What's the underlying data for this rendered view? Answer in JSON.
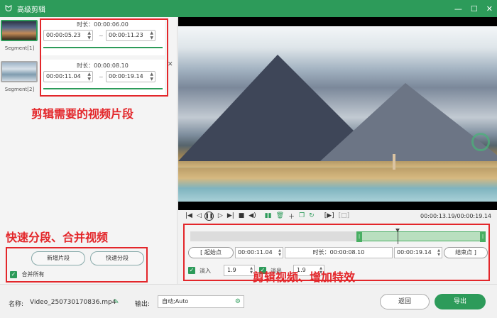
{
  "window": {
    "title": "高级剪辑"
  },
  "segments": [
    {
      "label": "Segment[1]",
      "duration": "时长：00:00:06.00",
      "start": "00:00:05.23",
      "end": "00:00:11.23"
    },
    {
      "label": "Segment[2]",
      "duration": "时长：00:00:08.10",
      "start": "00:00:11.04",
      "end": "00:00:19.14"
    }
  ],
  "left_actions": {
    "add_segment": "新增片段",
    "quick_split": "快速分段",
    "merge_all": "合并所有"
  },
  "annotations": {
    "segments": "剪辑需要的视频片段",
    "split": "快速分段、合并视频",
    "edit": "剪辑视频、增加特效"
  },
  "player": {
    "timecode": "00:00:13.19/00:00:19.14"
  },
  "clip_editor": {
    "start_label": "起始点",
    "start_value": "00:00:11.04",
    "duration": "时长：00:00:08.10",
    "end_value": "00:00:19.14",
    "end_label": "结束点",
    "fade_in_label": "淡入",
    "fade_in_value": "1.9",
    "fade_out_label": "淡出",
    "fade_out_value": "1.9"
  },
  "footer": {
    "name_label": "名称:",
    "filename": "Video_250730170836.mp4",
    "output_label": "输出:",
    "output_value": "自动;Auto",
    "back": "返回",
    "export": "导出"
  },
  "colors": {
    "accent": "#2d9b5a",
    "annotation": "#e3262a"
  }
}
